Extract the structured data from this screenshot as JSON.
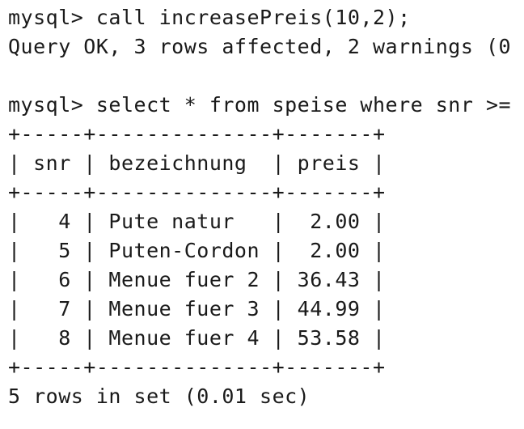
{
  "terminal": {
    "lines": [
      "mysql> call increasePreis(10,2);",
      "Query OK, 3 rows affected, 2 warnings (0",
      "",
      "mysql> select * from speise where snr >=",
      "+-----+--------------+-------+",
      "| snr | bezeichnung  | preis |",
      "+-----+--------------+-------+",
      "|   4 | Pute natur   |  2.00 |",
      "|   5 | Puten-Cordon |  2.00 |",
      "|   6 | Menue fuer 2 | 36.43 |",
      "|   7 | Menue fuer 3 | 44.99 |",
      "|   8 | Menue fuer 4 | 53.58 |",
      "+-----+--------------+-------+",
      "5 rows in set (0.01 sec)"
    ]
  }
}
